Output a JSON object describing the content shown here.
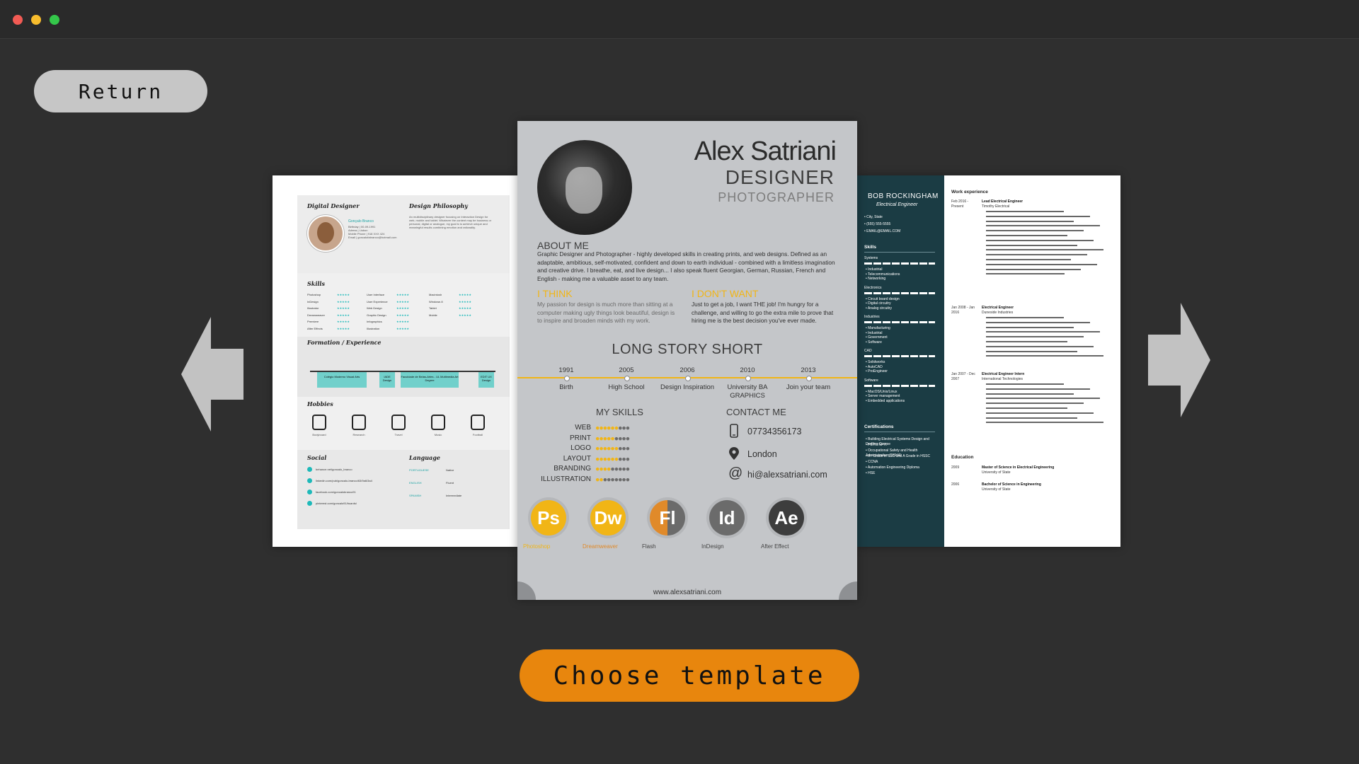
{
  "window": {
    "title": ""
  },
  "return_label": "Return",
  "choose_label": "Choose template",
  "colors": {
    "accent": "#e8860d",
    "background": "#2f2f2f",
    "yellow": "#f1b516",
    "teal": "#1eb9b9",
    "navy": "#1b3c44"
  },
  "icons": {
    "left_arrow": "arrow-left-icon",
    "right_arrow": "arrow-right-icon"
  },
  "left_template": {
    "header": "Digital Designer",
    "philosophy_title": "Design Philosophy",
    "philosophy_text": "An multidisciplinary designer focusing on Interaction Design for web, mobile and tablet. Whatever the content may be business or personal, digital or analogue, my goal is to achieve unique and meaningful results combining emotion and rationality.",
    "person_name": "Gonçalo Branco",
    "person_info": "Birthday | 00-09-1991\nAdress | Lisbon\nMobile Phone | 918 XXX 424\nEmail | goncalofabranco@hotmail.com",
    "skills_title": "Skills",
    "skills_col1": [
      "Photoshop",
      "InDesign",
      "Illustrator",
      "Dreamweaver",
      "Premiere",
      "After Effects"
    ],
    "skills_col2": [
      "User Interface",
      "User Experience",
      "Web Design",
      "Graphic Design",
      "Infographics",
      "Illustration"
    ],
    "skills_col3": [
      "Macintosh",
      "Windows 8",
      "Tablet",
      "Mobile"
    ],
    "formation_title": "Formation / Experience",
    "formation_bars": [
      "Colégio Moderno Visual Arts",
      "IADE Design",
      "Faculdade de Belas-Artes - UL Multimedia Art Degree",
      "EDIT UX Design"
    ],
    "hobbies_title": "Hobbies",
    "hobbies": [
      "Bodyboard",
      "Research",
      "Travel",
      "Music",
      "Football"
    ],
    "social_title": "Social",
    "social_links": [
      "behance.net/goncalo_branco",
      "linkedin.com/pub/goncalo-branco/63/9a6/3a4",
      "facebook.com/goncalobranco91",
      "pinterest.com/goncalo91/boards/"
    ],
    "language_title": "Language",
    "languages": [
      {
        "lang": "PORTUGUESE",
        "level": "Native"
      },
      {
        "lang": "ENGLISH",
        "level": "Fluent"
      },
      {
        "lang": "SPANISH",
        "level": "Intermediate"
      }
    ]
  },
  "center_template": {
    "name": "Alex Satriani",
    "role1": "DESIGNER",
    "role2": "PHOTOGRAPHER",
    "about_title": "ABOUT ME",
    "about_text": "Graphic Designer and Photographer - highly developed skills in creating prints, and web designs. Defined as an adaptable, ambitious, self-motivated, confident and down to earth individual - combined with a limitless imagination and creative drive. I breathe, eat, and live design... I also speak fluent Georgian, German, Russian, French and English - making me a valuable asset to any team.",
    "think_title": "I THINK",
    "think_text": "My passion for design is much more than sitting at a computer making ugly things look beautiful, design is to inspire and broaden minds with my work.",
    "dont_title": "I DON'T WANT",
    "dont_text": "Just to get a job, I want THE job! I'm hungry for a challenge, and willing to go the extra mile to prove that hiring me is the best decision you've ever made.",
    "story_title": "LONG STORY SHORT",
    "timeline": [
      {
        "year": "1991",
        "label": "Birth"
      },
      {
        "year": "2005",
        "label": "High School"
      },
      {
        "year": "2006",
        "label": "Design Inspiration"
      },
      {
        "year": "2010",
        "label": "University BA GRAPHICS"
      },
      {
        "year": "2013",
        "label": "Join your team"
      }
    ],
    "skills_title": "MY SKILLS",
    "skills": [
      {
        "name": "WEB",
        "level": 6
      },
      {
        "name": "PRINT",
        "level": 5
      },
      {
        "name": "LOGO",
        "level": 6
      },
      {
        "name": "LAYOUT",
        "level": 6
      },
      {
        "name": "BRANDING",
        "level": 4
      },
      {
        "name": "ILLUSTRATION",
        "level": 2
      }
    ],
    "skills_max": 9,
    "contact_title": "CONTACT ME",
    "phone": "07734356173",
    "location": "London",
    "email": "hi@alexsatriani.com",
    "software": [
      {
        "abbr": "Ps",
        "name": "Photoshop"
      },
      {
        "abbr": "Dw",
        "name": "Dreamweaver"
      },
      {
        "abbr": "Fl",
        "name": "Flash"
      },
      {
        "abbr": "Id",
        "name": "InDesign"
      },
      {
        "abbr": "Ae",
        "name": "After Effect"
      }
    ],
    "website": "www.alexsatriani.com"
  },
  "right_template": {
    "name": "BOB ROCKINGHAM",
    "role": "Electrical Engineer",
    "contact": [
      "City, State",
      "(555) 555-5555",
      "EMAIL@EMAIL.COM"
    ],
    "skills_title": "Skills",
    "skill_groups": [
      {
        "title": "Systems",
        "items": [
          "Industrial",
          "Telecommunications",
          "Networking"
        ]
      },
      {
        "title": "Electronics",
        "items": [
          "Circuit board design",
          "Digital circuitry",
          "Analog circuitry"
        ]
      },
      {
        "title": "Industries",
        "items": [
          "Manufacturing",
          "Industrial",
          "Government",
          "Software"
        ]
      },
      {
        "title": "CAD",
        "items": [
          "Solidworks",
          "AutoCAD",
          "ProEngineer"
        ]
      },
      {
        "title": "Software",
        "items": [
          "MacOS/Unix/Linux",
          "Server management",
          "Embedded applications"
        ]
      }
    ],
    "cert_title": "Certifications",
    "certs": [
      "Building Electrical Systems Design and Drafting Course",
      "PSTI / NPTI",
      "Occupational Safety and Health Administration (OSHA)",
      "A+ Grade in SSC and A Grade in HSSC",
      "CCNA",
      "Automation Engineering Diploma",
      "HSE"
    ],
    "work_title": "Work experience",
    "jobs": [
      {
        "dates": "Feb 2016 - Present",
        "title": "Lead Electrical Engineer",
        "company": "Timothy Electrical"
      },
      {
        "dates": "Jan 2008 - Jan 2016",
        "title": "Electrical Engineer",
        "company": "Duneside Industries"
      },
      {
        "dates": "Jan 2007 - Dec 2007",
        "title": "Electrical Engineer Intern",
        "company": "International Technologies"
      }
    ],
    "education_title": "Education",
    "education": [
      {
        "year": "2009",
        "degree": "Master of Science in Electrical Engineering",
        "school": "University of State"
      },
      {
        "year": "2006",
        "degree": "Bachelor of Science in Engineering",
        "school": "University of State"
      }
    ]
  }
}
